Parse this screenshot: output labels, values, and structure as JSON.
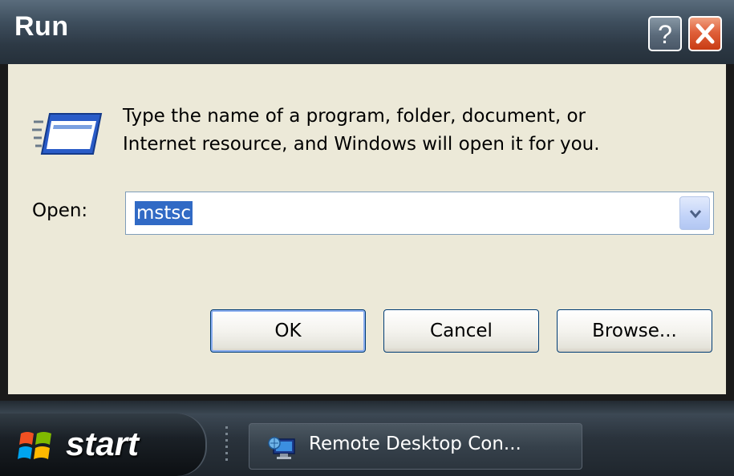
{
  "dialog": {
    "title": "Run",
    "description_line1": "Type the name of a program, folder, document, or",
    "description_line2": "Internet resource, and Windows will open it for you.",
    "open_label": "Open:",
    "open_value": "mstsc",
    "buttons": {
      "ok": "OK",
      "cancel": "Cancel",
      "browse": "Browse..."
    },
    "title_buttons": {
      "help": "?"
    }
  },
  "taskbar": {
    "start_label": "start",
    "items": [
      {
        "label": "Remote Desktop Con...",
        "icon": "remote-desktop-icon"
      }
    ]
  },
  "icons": {
    "dialog": "run-program-icon",
    "help": "help-icon",
    "close": "close-icon",
    "dropdown": "chevron-down-icon",
    "start": "windows-logo-icon"
  },
  "colors": {
    "selection": "#316ac5",
    "close_button": "#e0603a",
    "dialog_background": "#ece9d8",
    "titlebar": "#3e4e5d"
  }
}
